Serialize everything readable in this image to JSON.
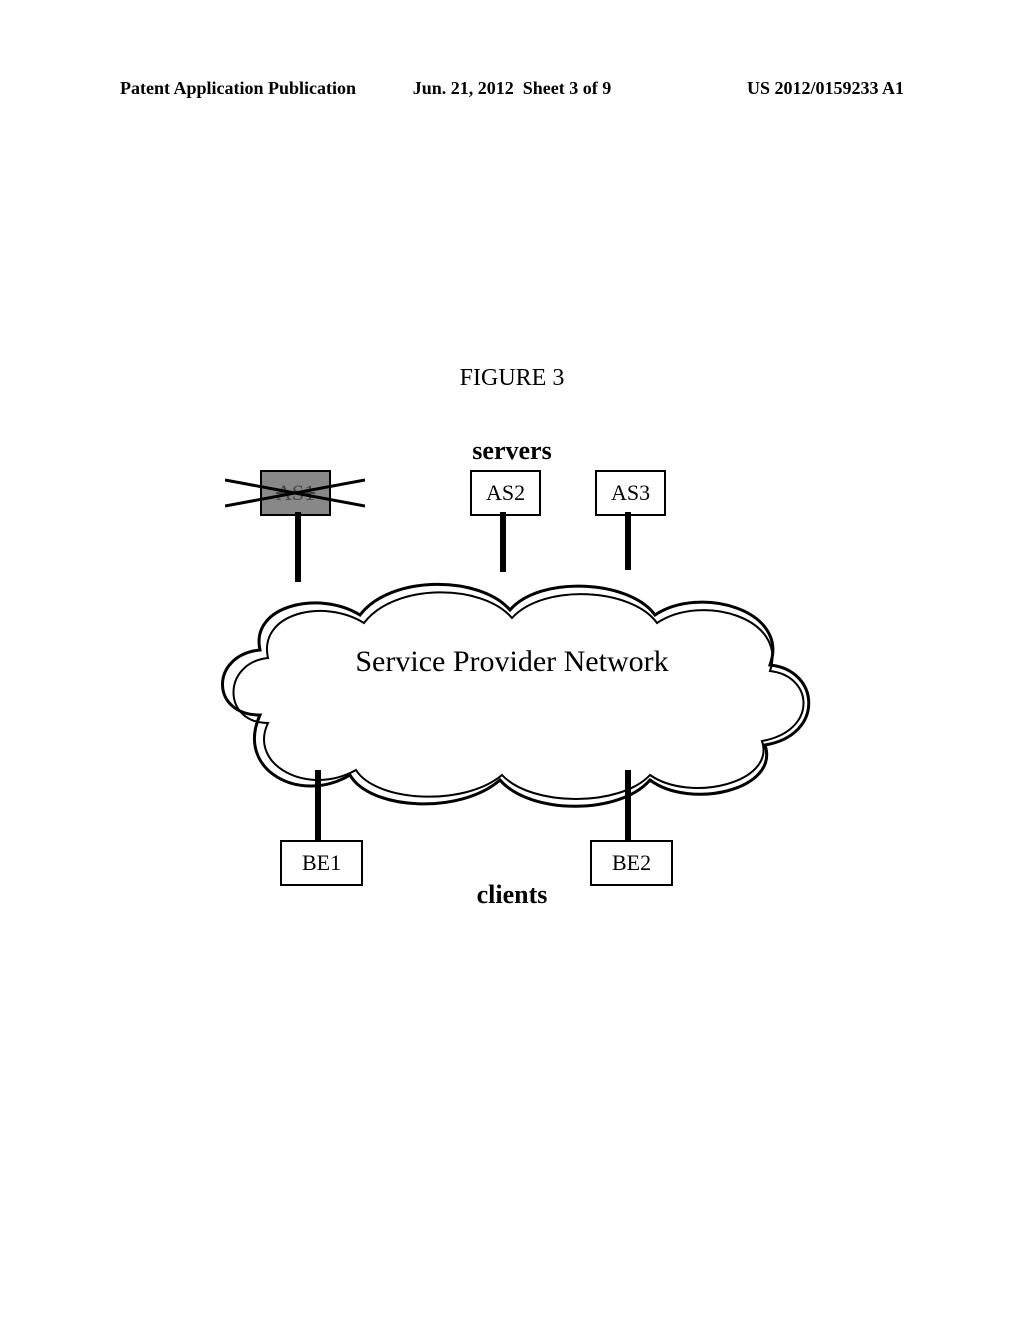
{
  "header": {
    "left": "Patent Application Publication",
    "middle_prefix": "Jun. 21, 2012",
    "middle_sheet": "Sheet 3 of 9",
    "right": "US 2012/0159233 A1"
  },
  "figure": {
    "title": "FIGURE 3",
    "servers_label": "servers",
    "clients_label": "clients",
    "cloud_label": "Service Provider Network",
    "nodes": {
      "as1": "AS1",
      "as2": "AS2",
      "as3": "AS3",
      "be1": "BE1",
      "be2": "BE2"
    }
  }
}
